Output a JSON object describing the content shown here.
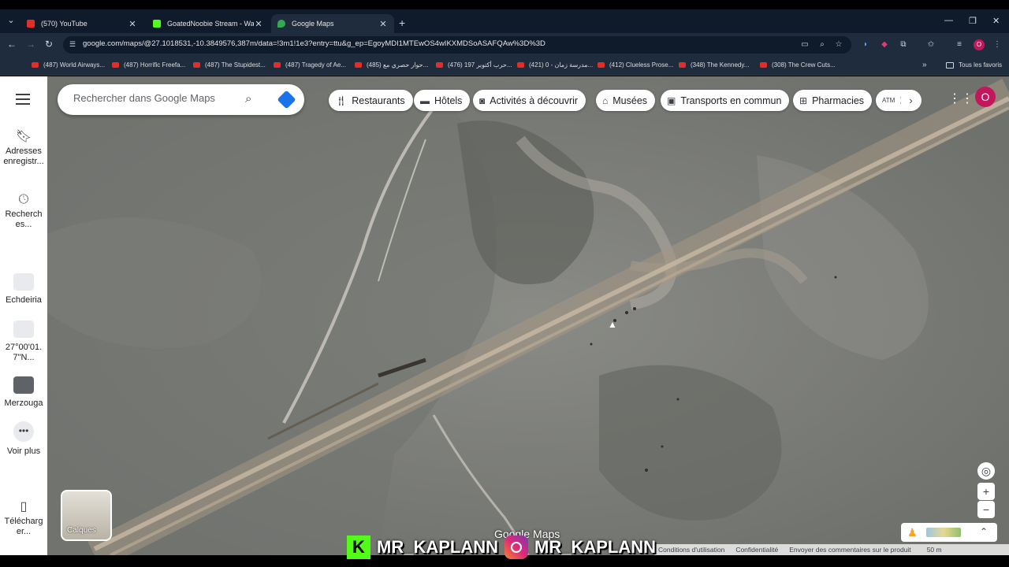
{
  "browser": {
    "tabs": [
      {
        "title": "(570) YouTube",
        "favicon_color": "#e52d27",
        "active": false
      },
      {
        "title": "GoatedNoobie Stream - Watch",
        "favicon_color": "#53fc18",
        "active": false
      },
      {
        "title": "Google Maps",
        "favicon_color": "#34a853",
        "active": true
      }
    ],
    "url": "google.com/maps/@27.1018531,-10.3849576,387m/data=!3m1!1e3?entry=ttu&g_ep=EgoyMDI1MTEwOS4wIKXMDSoASAFQAw%3D%3D",
    "bookmarks": [
      "(487) World Airways...",
      "(487) Horrific Freefa...",
      "(487) The Stupidest...",
      "(487) Tragedy of Ae...",
      "(485) حوار حصري مع...",
      "(476) حرب أكتوبر 197...",
      "(421) مدرسة زمان - 0...",
      "(412) Clueless Prose...",
      "(348) The Kennedy...",
      "(308) The Crew Cuts..."
    ],
    "all_bookmarks": "Tous les favoris",
    "profile_initial": "O"
  },
  "maps": {
    "search_placeholder": "Rechercher dans Google Maps",
    "rail": {
      "saved": "Adresses enregistr...",
      "recents": "Recherch es...",
      "recent_places": [
        "Echdeiria",
        "27°00'01. 7\"N...",
        "Merzouga"
      ],
      "more": "Voir plus",
      "download": "Télécharg er..."
    },
    "chips": [
      {
        "label": "Restaurants",
        "icon": "fork-knife-icon"
      },
      {
        "label": "Hôtels",
        "icon": "bed-icon"
      },
      {
        "label": "Activités à découvrir",
        "icon": "camera-icon"
      },
      {
        "label": "Musées",
        "icon": "museum-icon"
      },
      {
        "label": "Transports en commun",
        "icon": "train-icon"
      },
      {
        "label": "Pharmacies",
        "icon": "pharmacy-icon"
      },
      {
        "label": "D",
        "icon": "atm-icon"
      }
    ],
    "layers_label": "Calques",
    "account_initial": "O",
    "logo": "Google Maps",
    "footer": {
      "terms": "Conditions d'utilisation",
      "privacy": "Confidentialité",
      "feedback": "Envoyer des commentaires sur le produit",
      "scale": "50 m"
    }
  },
  "overlay": {
    "kick_handle": "MR_KAPLANN",
    "instagram_handle": "MR_KAPLANN"
  }
}
